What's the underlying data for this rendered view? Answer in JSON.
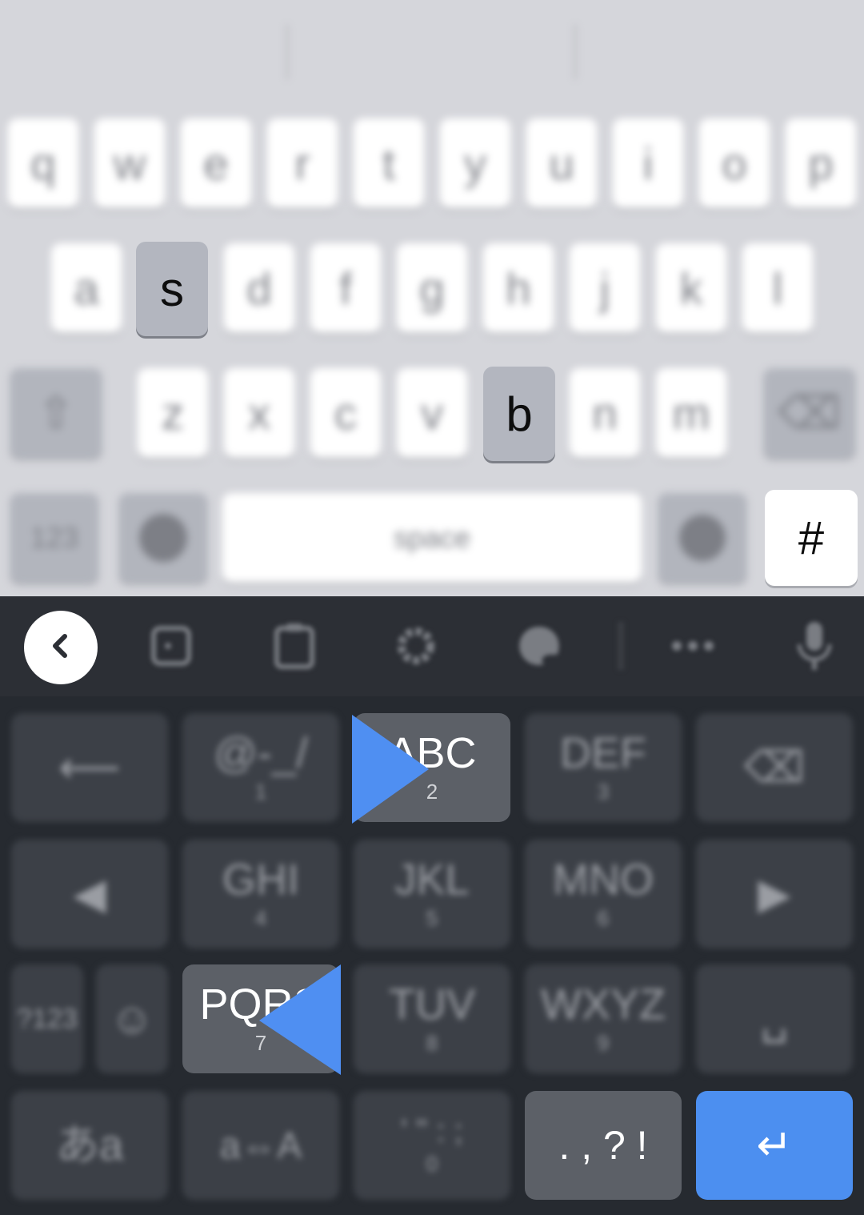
{
  "light_keyboard": {
    "row1": [
      "q",
      "w",
      "e",
      "r",
      "t",
      "y",
      "u",
      "i",
      "o",
      "p"
    ],
    "row2": [
      "a",
      "s",
      "d",
      "f",
      "g",
      "h",
      "j",
      "k",
      "l"
    ],
    "row3": [
      "z",
      "x",
      "c",
      "v",
      "b",
      "n",
      "m"
    ],
    "num_key": "123",
    "space_label": "space",
    "hash_key": "#",
    "focused_keys": [
      "s",
      "b"
    ]
  },
  "dark_keyboard": {
    "toolbar": {
      "back_icon": "chevron-left-icon",
      "icons": [
        "sticker-icon",
        "clipboard-icon",
        "gear-icon",
        "palette-icon",
        "more-icon",
        "mic-icon"
      ]
    },
    "rows": {
      "r1": [
        {
          "main": "⟵",
          "sub": ""
        },
        {
          "main": "@-_/",
          "sub": "1"
        },
        {
          "main": "ABC",
          "sub": "2"
        },
        {
          "main": "DEF",
          "sub": "3"
        },
        {
          "main": "⌫",
          "sub": ""
        }
      ],
      "r2": [
        {
          "main": "◀",
          "sub": ""
        },
        {
          "main": "GHI",
          "sub": "4"
        },
        {
          "main": "JKL",
          "sub": "5"
        },
        {
          "main": "MNO",
          "sub": "6"
        },
        {
          "main": "▶",
          "sub": ""
        }
      ],
      "r3": [
        {
          "main": "?123",
          "sub": ""
        },
        {
          "main": "☺",
          "sub": ""
        },
        {
          "main": "PQRS",
          "sub": "7"
        },
        {
          "main": "TUV",
          "sub": "8"
        },
        {
          "main": "WXYZ",
          "sub": "9"
        },
        {
          "main": "␣",
          "sub": ""
        }
      ],
      "r4": [
        {
          "main": "あa",
          "sub": ""
        },
        {
          "main": "a⇔A",
          "sub": ""
        },
        {
          "main": "' \" : ;",
          "sub": "0"
        },
        {
          "main": ". , ? !",
          "sub": ""
        },
        {
          "main": "↵",
          "sub": ""
        }
      ]
    }
  },
  "colors": {
    "pointer": "#4f8ff2",
    "enter_key": "#4c8ff0",
    "dark_bg": "#262a30",
    "light_bg": "#d5d6db"
  }
}
